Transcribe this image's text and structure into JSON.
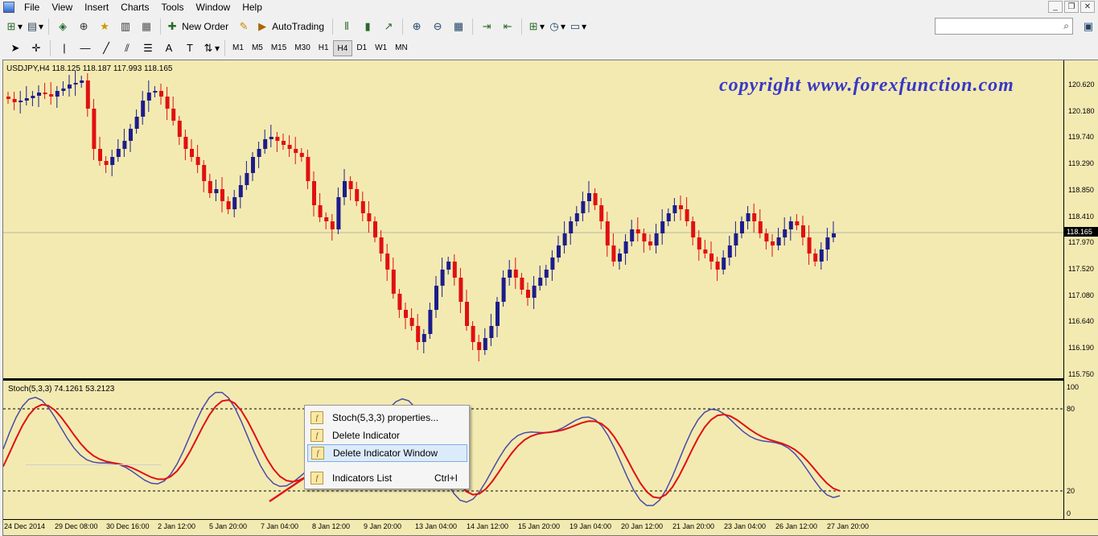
{
  "menubar": {
    "items": [
      "File",
      "View",
      "Insert",
      "Charts",
      "Tools",
      "Window",
      "Help"
    ]
  },
  "toolbar": {
    "new_order": "New Order",
    "autotrading": "AutoTrading"
  },
  "timeframes": [
    "M1",
    "M5",
    "M15",
    "M30",
    "H1",
    "H4",
    "D1",
    "W1",
    "MN"
  ],
  "active_timeframe": "H4",
  "chart": {
    "header": "USDJPY,H4  118.125 118.187 117.993 118.165",
    "watermark": "copyright www.forexfunction.com",
    "current_price": "118.165",
    "price_ticks": [
      "120.620",
      "120.180",
      "119.740",
      "119.290",
      "118.850",
      "118.410",
      "117.970",
      "117.520",
      "117.080",
      "116.640",
      "116.190",
      "115.750"
    ],
    "time_ticks": [
      "24 Dec 2014",
      "29 Dec 08:00",
      "30 Dec 16:00",
      "2 Jan 12:00",
      "5 Jan 20:00",
      "7 Jan 04:00",
      "8 Jan 12:00",
      "9 Jan 20:00",
      "13 Jan 04:00",
      "14 Jan 12:00",
      "15 Jan 20:00",
      "19 Jan 04:00",
      "20 Jan 12:00",
      "21 Jan 20:00",
      "23 Jan 04:00",
      "26 Jan 12:00",
      "27 Jan 20:00"
    ]
  },
  "indicator": {
    "label": "Stoch(5,3,3) 74.1261 53.2123",
    "levels": [
      "100",
      "80",
      "20",
      "0"
    ]
  },
  "context_menu": {
    "items": [
      {
        "label": "Stoch(5,3,3) properties...",
        "shortcut": ""
      },
      {
        "label": "Delete Indicator",
        "shortcut": ""
      },
      {
        "label": "Delete Indicator Window",
        "shortcut": ""
      },
      {
        "label": "Indicators List",
        "shortcut": "Ctrl+I"
      }
    ],
    "highlighted": "Delete Indicator Window"
  },
  "colors": {
    "chart_bg": "#f3eab2",
    "bull": "#1c1c8c",
    "bear": "#e01010",
    "stoch_main": "#4a4aa8",
    "stoch_signal": "#e01010",
    "watermark": "#3838c8"
  }
}
